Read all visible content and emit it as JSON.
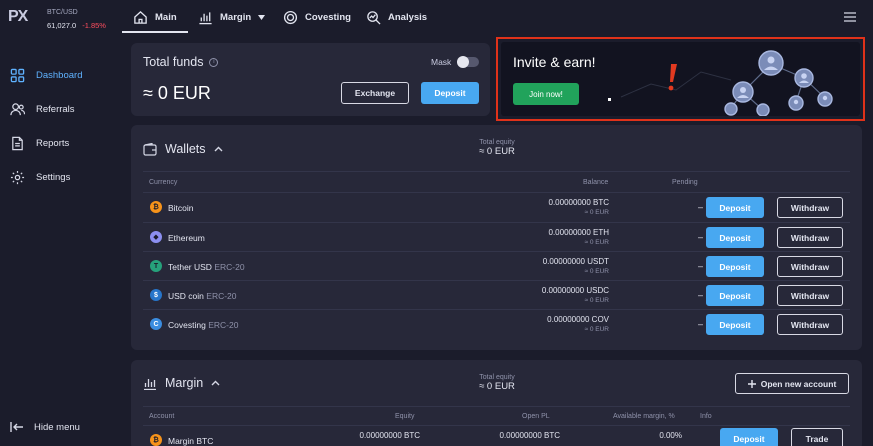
{
  "ticker": {
    "logo": "PX",
    "pair": "BTC/USD",
    "price": "61,027.0",
    "change": "-1.85%"
  },
  "sidebar": {
    "items": [
      {
        "label": "Dashboard",
        "icon": "grid-icon",
        "active": true
      },
      {
        "label": "Referrals",
        "icon": "users-icon"
      },
      {
        "label": "Reports",
        "icon": "document-icon"
      },
      {
        "label": "Settings",
        "icon": "gear-icon"
      }
    ],
    "hide_label": "Hide menu"
  },
  "topbar": {
    "tabs": [
      {
        "label": "Main",
        "icon": "home-icon"
      },
      {
        "label": "Margin",
        "icon": "bar-chart-icon"
      },
      {
        "label": "Covesting",
        "icon": "covesting-icon"
      },
      {
        "label": "Analysis",
        "icon": "analysis-icon"
      }
    ]
  },
  "funds": {
    "title": "Total funds",
    "value": "≈ 0 EUR",
    "mask_label": "Mask",
    "exchange_label": "Exchange",
    "deposit_label": "Deposit"
  },
  "invite": {
    "title": "Invite & earn!",
    "button": "Join now!"
  },
  "wallets": {
    "title": "Wallets",
    "equity_label": "Total equity",
    "equity_value": "≈ 0 EUR",
    "columns": {
      "currency": "Currency",
      "balance": "Balance",
      "pending": "Pending"
    },
    "deposit_label": "Deposit",
    "withdraw_label": "Withdraw",
    "rows": [
      {
        "name": "Bitcoin",
        "tag": "",
        "balance": "0.00000000 BTC",
        "fiat": "≈ 0 EUR",
        "pending": "–",
        "color": "#f7931a",
        "glyph": "₿"
      },
      {
        "name": "Ethereum",
        "tag": "",
        "balance": "0.00000000 ETH",
        "fiat": "≈ 0 EUR",
        "pending": "–",
        "color": "#8c8ff0",
        "glyph": "◆"
      },
      {
        "name": "Tether USD",
        "tag": "ERC-20",
        "balance": "0.00000000 USDT",
        "fiat": "≈ 0 EUR",
        "pending": "–",
        "color": "#26a17b",
        "glyph": "T"
      },
      {
        "name": "USD coin",
        "tag": "ERC-20",
        "balance": "0.00000000 USDC",
        "fiat": "≈ 0 EUR",
        "pending": "–",
        "color": "#2775ca",
        "glyph": "$"
      },
      {
        "name": "Covesting",
        "tag": "ERC-20",
        "balance": "0.00000000 COV",
        "fiat": "≈ 0 EUR",
        "pending": "–",
        "color": "#3b8de0",
        "glyph": "C"
      }
    ]
  },
  "margin": {
    "title": "Margin",
    "equity_label": "Total equity",
    "equity_value": "≈ 0 EUR",
    "open_account_label": "Open new account",
    "columns": {
      "account": "Account",
      "equity": "Equity",
      "open_pl": "Open PL",
      "available": "Available margin, %",
      "info": "Info"
    },
    "row": {
      "name": "Margin BTC",
      "equity": "0.00000000 BTC",
      "open_pl": "0.00000000 BTC",
      "available": "0.00%",
      "deposit_label": "Deposit",
      "trade_label": "Trade"
    }
  }
}
